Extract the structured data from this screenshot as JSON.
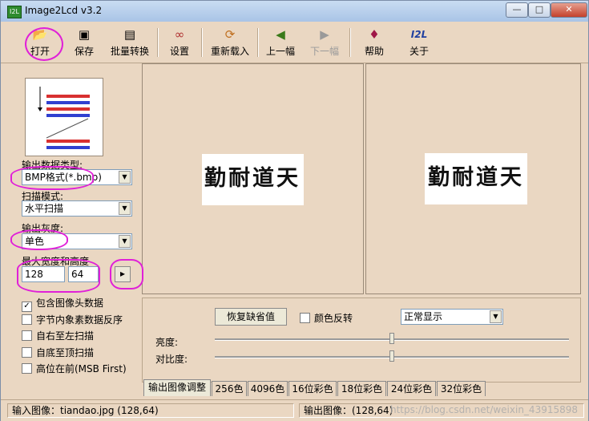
{
  "window": {
    "title": "Image2Lcd v3.2",
    "app_icon_text": "I2L",
    "min_label": "—",
    "max_label": "□",
    "close_label": "✕"
  },
  "toolbar": {
    "open": "打开",
    "save": "保存",
    "batch": "批量转换",
    "settings": "设置",
    "reload": "重新载入",
    "prev": "上一幅",
    "next": "下一幅",
    "help": "帮助",
    "about": "关于",
    "icons": {
      "open": "folder-open-icon",
      "save": "floppy-icon",
      "batch": "batch-icon",
      "settings": "glasses-icon",
      "reload": "reload-icon",
      "prev": "arrow-left-icon",
      "next": "arrow-right-icon",
      "help": "help-book-icon",
      "about": "about-i2l-icon"
    }
  },
  "left": {
    "output_type_label": "输出数据类型:",
    "output_type_value": "BMP格式(*.bmp)",
    "scan_mode_label": "扫描模式:",
    "scan_mode_value": "水平扫描",
    "gray_label": "输出灰度:",
    "gray_value": "单色",
    "size_label": "最大宽度和高度",
    "width_value": "128",
    "height_value": "64",
    "apply_arrow": "▸",
    "checks": [
      {
        "label": "包含图像头数据",
        "checked": true
      },
      {
        "label": "字节内象素数据反序",
        "checked": false
      },
      {
        "label": "自右至左扫描",
        "checked": false
      },
      {
        "label": "自底至顶扫描",
        "checked": false
      },
      {
        "label": "高位在前(MSB First)",
        "checked": false
      }
    ]
  },
  "preview": {
    "input_text": "勤耐道天",
    "output_text": "勤耐道天"
  },
  "adjust": {
    "restore_button": "恢复缺省值",
    "invert_label": "颜色反转",
    "display_mode": "正常显示",
    "brightness_label": "亮度:",
    "contrast_label": "对比度:",
    "brightness": 0.5,
    "contrast": 0.5
  },
  "tabs": [
    "输出图像调整",
    "256色",
    "4096色",
    "16位彩色",
    "18位彩色",
    "24位彩色",
    "32位彩色"
  ],
  "status": {
    "input": "输入图像：tiandao.jpg (128,64)",
    "output": "输出图像：(128,64)",
    "watermark": "https://blog.csdn.net/weixin_43915898"
  },
  "colors": {
    "panel": "#ead7c2",
    "highlight": "#e020d8"
  }
}
